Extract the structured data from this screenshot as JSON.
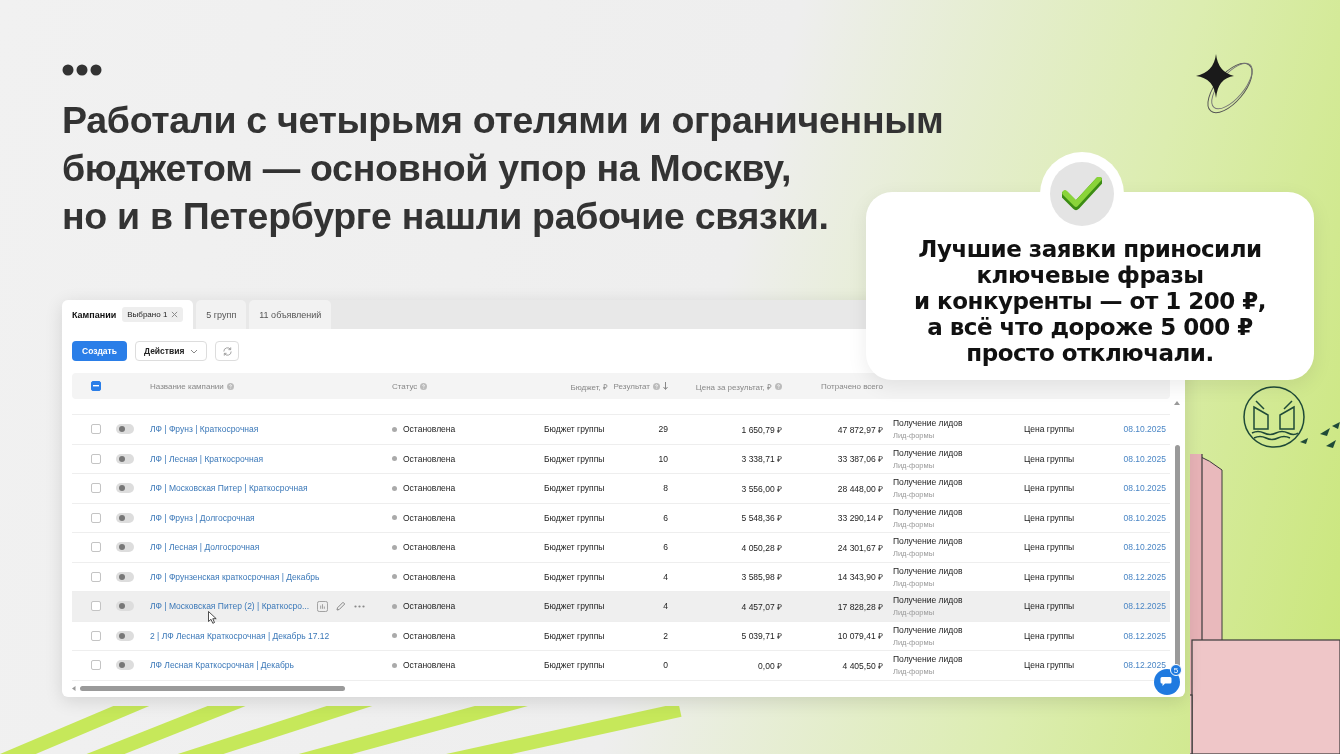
{
  "slide": {
    "title_lines": [
      "Работали с четырьмя отелями и ограниченным",
      "бюджетом — основной упор на Москву,",
      "но и в Петербурге нашли рабочие связки."
    ]
  },
  "panel": {
    "tabs": [
      {
        "label": "Кампании",
        "selected": true,
        "chip": "Выбрано 1"
      },
      {
        "label": "5 групп",
        "selected": false
      },
      {
        "label": "11 объявлений",
        "selected": false
      }
    ],
    "create_button": "Создать",
    "actions_button": "Действия",
    "header_checkbox": {
      "indeterminate": true
    },
    "columns": [
      {
        "label": "Название кампании",
        "help": true,
        "sorted": false
      },
      {
        "label": "Статус",
        "help": true,
        "sorted": false
      },
      {
        "label": "Бюджет, ₽",
        "help": false,
        "sorted": false
      },
      {
        "label": "Результат",
        "help": true,
        "sorted": true
      },
      {
        "label": "Цена за результат, ₽",
        "help": true,
        "sorted": false
      },
      {
        "label": "Потрачено всего",
        "help": false,
        "sorted": false
      }
    ],
    "rows": [
      {
        "checked": false,
        "on": false,
        "hovered": false,
        "name": "ЛФ | Фрунз | Краткосрочная",
        "status": "Остановлена",
        "budget": "Бюджет группы",
        "result": "29",
        "price": "1 650,79 ₽",
        "spent": "47 872,97 ₽",
        "goal": "Получение лидов",
        "goal_type": "Лид-формы",
        "strategy": "Цена группы",
        "date": "08.10.2025"
      },
      {
        "checked": false,
        "on": false,
        "hovered": false,
        "name": "ЛФ | Лесная | Краткосрочная",
        "status": "Остановлена",
        "budget": "Бюджет группы",
        "result": "10",
        "price": "3 338,71 ₽",
        "spent": "33 387,06 ₽",
        "goal": "Получение лидов",
        "goal_type": "Лид-формы",
        "strategy": "Цена группы",
        "date": "08.10.2025"
      },
      {
        "checked": false,
        "on": false,
        "hovered": false,
        "name": "ЛФ | Московская Питер | Краткосрочная",
        "status": "Остановлена",
        "budget": "Бюджет группы",
        "result": "8",
        "price": "3 556,00 ₽",
        "spent": "28 448,00 ₽",
        "goal": "Получение лидов",
        "goal_type": "Лид-формы",
        "strategy": "Цена группы",
        "date": "08.10.2025"
      },
      {
        "checked": false,
        "on": false,
        "hovered": false,
        "name": "ЛФ | Фрунз | Долгосрочная",
        "status": "Остановлена",
        "budget": "Бюджет группы",
        "result": "6",
        "price": "5 548,36 ₽",
        "spent": "33 290,14 ₽",
        "goal": "Получение лидов",
        "goal_type": "Лид-формы",
        "strategy": "Цена группы",
        "date": "08.10.2025"
      },
      {
        "checked": false,
        "on": false,
        "hovered": false,
        "name": "ЛФ | Лесная | Долгосрочная",
        "status": "Остановлена",
        "budget": "Бюджет группы",
        "result": "6",
        "price": "4 050,28 ₽",
        "spent": "24 301,67 ₽",
        "goal": "Получение лидов",
        "goal_type": "Лид-формы",
        "strategy": "Цена группы",
        "date": "08.10.2025"
      },
      {
        "checked": false,
        "on": false,
        "hovered": false,
        "name": "ЛФ | Фрунзенская краткосрочная | Декабрь",
        "status": "Остановлена",
        "budget": "Бюджет группы",
        "result": "4",
        "price": "3 585,98 ₽",
        "spent": "14 343,90 ₽",
        "goal": "Получение лидов",
        "goal_type": "Лид-формы",
        "strategy": "Цена группы",
        "date": "08.12.2025"
      },
      {
        "checked": false,
        "on": false,
        "hovered": true,
        "name": "ЛФ | Московская Питер (2) | Краткосро...",
        "status": "Остановлена",
        "budget": "Бюджет группы",
        "result": "4",
        "price": "4 457,07 ₽",
        "spent": "17 828,28 ₽",
        "goal": "Получение лидов",
        "goal_type": "Лид-формы",
        "strategy": "Цена группы",
        "date": "08.12.2025"
      },
      {
        "checked": false,
        "on": false,
        "hovered": false,
        "name": "2 | ЛФ Лесная Краткосрочная | Декабрь 17.12",
        "status": "Остановлена",
        "budget": "Бюджет группы",
        "result": "2",
        "price": "5 039,71 ₽",
        "spent": "10 079,41 ₽",
        "goal": "Получение лидов",
        "goal_type": "Лид-формы",
        "strategy": "Цена группы",
        "date": "08.12.2025"
      },
      {
        "checked": false,
        "on": false,
        "hovered": false,
        "name": "ЛФ Лесная Краткосрочная | Декабрь",
        "status": "Остановлена",
        "budget": "Бюджет группы",
        "result": "0",
        "price": "0,00 ₽",
        "spent": "4 405,50 ₽",
        "goal": "Получение лидов",
        "goal_type": "Лид-формы",
        "strategy": "Цена группы",
        "date": "08.12.2025"
      }
    ],
    "chat_badge": "5"
  },
  "callout": {
    "lines": [
      "Лучшие заявки приносили",
      "ключевые фразы",
      "и конкуренты — от 1 200 ₽,",
      "а всё что дороже 5 000 ₽",
      "просто отключали."
    ]
  }
}
